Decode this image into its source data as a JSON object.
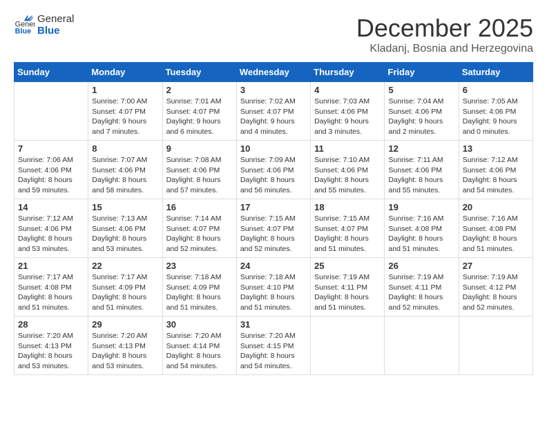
{
  "header": {
    "logo_general": "General",
    "logo_blue": "Blue",
    "month_title": "December 2025",
    "location": "Kladanj, Bosnia and Herzegovina"
  },
  "days_of_week": [
    "Sunday",
    "Monday",
    "Tuesday",
    "Wednesday",
    "Thursday",
    "Friday",
    "Saturday"
  ],
  "weeks": [
    [
      {
        "day": "",
        "text": ""
      },
      {
        "day": "1",
        "text": "Sunrise: 7:00 AM\nSunset: 4:07 PM\nDaylight: 9 hours\nand 7 minutes."
      },
      {
        "day": "2",
        "text": "Sunrise: 7:01 AM\nSunset: 4:07 PM\nDaylight: 9 hours\nand 6 minutes."
      },
      {
        "day": "3",
        "text": "Sunrise: 7:02 AM\nSunset: 4:07 PM\nDaylight: 9 hours\nand 4 minutes."
      },
      {
        "day": "4",
        "text": "Sunrise: 7:03 AM\nSunset: 4:06 PM\nDaylight: 9 hours\nand 3 minutes."
      },
      {
        "day": "5",
        "text": "Sunrise: 7:04 AM\nSunset: 4:06 PM\nDaylight: 9 hours\nand 2 minutes."
      },
      {
        "day": "6",
        "text": "Sunrise: 7:05 AM\nSunset: 4:06 PM\nDaylight: 9 hours\nand 0 minutes."
      }
    ],
    [
      {
        "day": "7",
        "text": "Sunrise: 7:06 AM\nSunset: 4:06 PM\nDaylight: 8 hours\nand 59 minutes."
      },
      {
        "day": "8",
        "text": "Sunrise: 7:07 AM\nSunset: 4:06 PM\nDaylight: 8 hours\nand 58 minutes."
      },
      {
        "day": "9",
        "text": "Sunrise: 7:08 AM\nSunset: 4:06 PM\nDaylight: 8 hours\nand 57 minutes."
      },
      {
        "day": "10",
        "text": "Sunrise: 7:09 AM\nSunset: 4:06 PM\nDaylight: 8 hours\nand 56 minutes."
      },
      {
        "day": "11",
        "text": "Sunrise: 7:10 AM\nSunset: 4:06 PM\nDaylight: 8 hours\nand 55 minutes."
      },
      {
        "day": "12",
        "text": "Sunrise: 7:11 AM\nSunset: 4:06 PM\nDaylight: 8 hours\nand 55 minutes."
      },
      {
        "day": "13",
        "text": "Sunrise: 7:12 AM\nSunset: 4:06 PM\nDaylight: 8 hours\nand 54 minutes."
      }
    ],
    [
      {
        "day": "14",
        "text": "Sunrise: 7:12 AM\nSunset: 4:06 PM\nDaylight: 8 hours\nand 53 minutes."
      },
      {
        "day": "15",
        "text": "Sunrise: 7:13 AM\nSunset: 4:06 PM\nDaylight: 8 hours\nand 53 minutes."
      },
      {
        "day": "16",
        "text": "Sunrise: 7:14 AM\nSunset: 4:07 PM\nDaylight: 8 hours\nand 52 minutes."
      },
      {
        "day": "17",
        "text": "Sunrise: 7:15 AM\nSunset: 4:07 PM\nDaylight: 8 hours\nand 52 minutes."
      },
      {
        "day": "18",
        "text": "Sunrise: 7:15 AM\nSunset: 4:07 PM\nDaylight: 8 hours\nand 51 minutes."
      },
      {
        "day": "19",
        "text": "Sunrise: 7:16 AM\nSunset: 4:08 PM\nDaylight: 8 hours\nand 51 minutes."
      },
      {
        "day": "20",
        "text": "Sunrise: 7:16 AM\nSunset: 4:08 PM\nDaylight: 8 hours\nand 51 minutes."
      }
    ],
    [
      {
        "day": "21",
        "text": "Sunrise: 7:17 AM\nSunset: 4:08 PM\nDaylight: 8 hours\nand 51 minutes."
      },
      {
        "day": "22",
        "text": "Sunrise: 7:17 AM\nSunset: 4:09 PM\nDaylight: 8 hours\nand 51 minutes."
      },
      {
        "day": "23",
        "text": "Sunrise: 7:18 AM\nSunset: 4:09 PM\nDaylight: 8 hours\nand 51 minutes."
      },
      {
        "day": "24",
        "text": "Sunrise: 7:18 AM\nSunset: 4:10 PM\nDaylight: 8 hours\nand 51 minutes."
      },
      {
        "day": "25",
        "text": "Sunrise: 7:19 AM\nSunset: 4:11 PM\nDaylight: 8 hours\nand 51 minutes."
      },
      {
        "day": "26",
        "text": "Sunrise: 7:19 AM\nSunset: 4:11 PM\nDaylight: 8 hours\nand 52 minutes."
      },
      {
        "day": "27",
        "text": "Sunrise: 7:19 AM\nSunset: 4:12 PM\nDaylight: 8 hours\nand 52 minutes."
      }
    ],
    [
      {
        "day": "28",
        "text": "Sunrise: 7:20 AM\nSunset: 4:13 PM\nDaylight: 8 hours\nand 53 minutes."
      },
      {
        "day": "29",
        "text": "Sunrise: 7:20 AM\nSunset: 4:13 PM\nDaylight: 8 hours\nand 53 minutes."
      },
      {
        "day": "30",
        "text": "Sunrise: 7:20 AM\nSunset: 4:14 PM\nDaylight: 8 hours\nand 54 minutes."
      },
      {
        "day": "31",
        "text": "Sunrise: 7:20 AM\nSunset: 4:15 PM\nDaylight: 8 hours\nand 54 minutes."
      },
      {
        "day": "",
        "text": ""
      },
      {
        "day": "",
        "text": ""
      },
      {
        "day": "",
        "text": ""
      }
    ]
  ]
}
